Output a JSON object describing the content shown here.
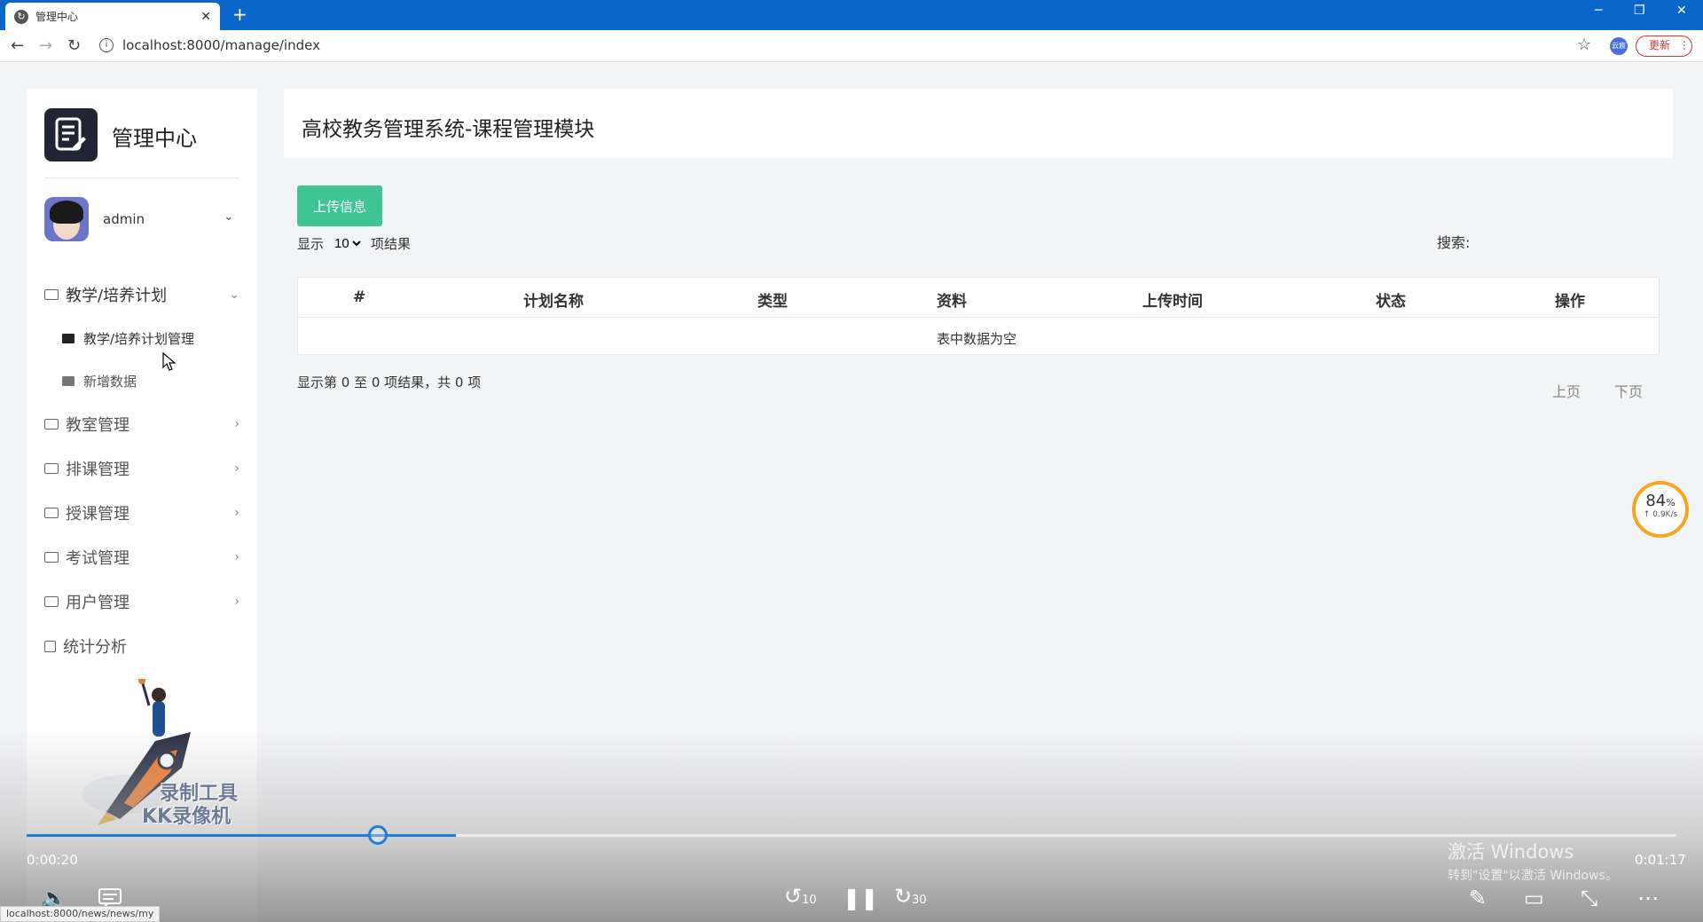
{
  "browser": {
    "tab_title": "管理中心",
    "url": "localhost:8000/manage/index",
    "update_label": "更新",
    "profile_label": "云宸",
    "status_url": "localhost:8000/news/news/my"
  },
  "sidebar": {
    "brand": "管理中心",
    "username": "admin",
    "menu": [
      {
        "label": "教学/培养计划",
        "icon": "folder-icon",
        "open": true
      },
      {
        "label": "教室管理",
        "icon": "folder-icon"
      },
      {
        "label": "排课管理",
        "icon": "folder-icon"
      },
      {
        "label": "授课管理",
        "icon": "folder-icon"
      },
      {
        "label": "考试管理",
        "icon": "folder-icon"
      },
      {
        "label": "用户管理",
        "icon": "folder-icon"
      },
      {
        "label": "统计分析",
        "icon": "stats-icon"
      }
    ],
    "submenu": [
      {
        "label": "教学/培养计划管理"
      },
      {
        "label": "新增数据"
      }
    ]
  },
  "main": {
    "title": "高校教务管理系统-课程管理模块",
    "upload_button": "上传信息",
    "show_prefix": "显示",
    "page_length": "10",
    "show_suffix": "项结果",
    "search_label": "搜索:",
    "table": {
      "columns": [
        "#",
        "计划名称",
        "类型",
        "资料",
        "上传时间",
        "状态",
        "操作"
      ],
      "empty_text": "表中数据为空"
    },
    "info": "显示第 0 至 0 项结果，共 0 项",
    "prev": "上页",
    "next": "下页"
  },
  "speed_widget": {
    "percent": "84",
    "unit": "%",
    "rate": "↑ 0.9K/s"
  },
  "video": {
    "current_time": "0:00:20",
    "total_time": "0:01:17",
    "progress": 0.26,
    "watermark_line1": "录制工具",
    "watermark_line2": "KK录像机",
    "activation_line1": "激活 Windows",
    "activation_line2": "转到\"设置\"以激活 Windows。",
    "skip_back": "10",
    "skip_forward": "30"
  },
  "colors": {
    "tabbar": "#0a66c8",
    "upload_button": "#3fc495",
    "progress": "#1f7ed6",
    "speed_ring": "#f5a623"
  }
}
